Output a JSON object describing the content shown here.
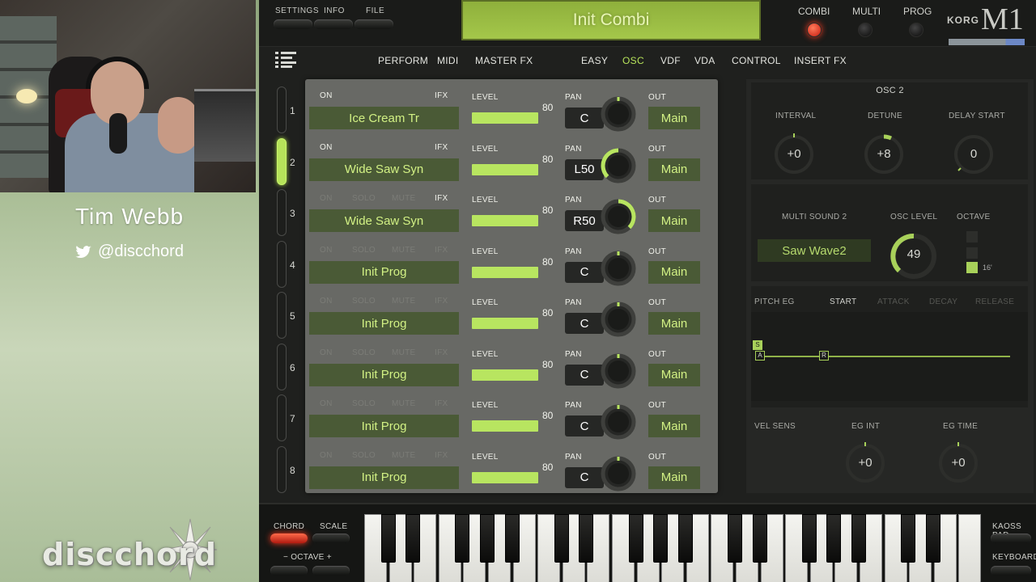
{
  "stream": {
    "host_name": "Tim Webb",
    "host_handle": "@discchord",
    "brand_word": "discchord"
  },
  "topbar": {
    "settings": "SETTINGS",
    "info": "INFO",
    "file": "FILE",
    "display_title": "Init Combi",
    "modes": [
      {
        "label": "COMBI",
        "active": true
      },
      {
        "label": "MULTI",
        "active": false
      },
      {
        "label": "PROG",
        "active": false
      }
    ],
    "brand": "KORG",
    "model": "M1"
  },
  "nav": {
    "items": [
      "PERFORM",
      "MIDI",
      "MASTER FX",
      "EASY",
      "OSC",
      "VDF",
      "VDA",
      "CONTROL",
      "INSERT FX"
    ],
    "active": "OSC"
  },
  "parts": {
    "numbers": [
      "1",
      "2",
      "3",
      "4",
      "5",
      "6",
      "7",
      "8"
    ],
    "active_index": 1
  },
  "timbres": {
    "labels": {
      "on": "ON",
      "solo": "SOLO",
      "mute": "MUTE",
      "ifx": "IFX",
      "level": "LEVEL",
      "pan": "PAN",
      "out": "OUT"
    },
    "rows": [
      {
        "program": "Ice Cream Tr",
        "level": 80,
        "pan": "C",
        "pan_value": 0,
        "out": "Main",
        "on_lit": true,
        "ifx_lit": true
      },
      {
        "program": "Wide Saw Syn",
        "level": 80,
        "pan": "L50",
        "pan_value": -50,
        "out": "Main",
        "on_lit": true,
        "ifx_lit": true
      },
      {
        "program": "Wide Saw Syn",
        "level": 80,
        "pan": "R50",
        "pan_value": 50,
        "out": "Main",
        "on_lit": false,
        "ifx_lit": true
      },
      {
        "program": "Init Prog",
        "level": 80,
        "pan": "C",
        "pan_value": 0,
        "out": "Main",
        "on_lit": false,
        "ifx_lit": false
      },
      {
        "program": "Init Prog",
        "level": 80,
        "pan": "C",
        "pan_value": 0,
        "out": "Main",
        "on_lit": false,
        "ifx_lit": false
      },
      {
        "program": "Init Prog",
        "level": 80,
        "pan": "C",
        "pan_value": 0,
        "out": "Main",
        "on_lit": false,
        "ifx_lit": false
      },
      {
        "program": "Init Prog",
        "level": 80,
        "pan": "C",
        "pan_value": 0,
        "out": "Main",
        "on_lit": false,
        "ifx_lit": false
      },
      {
        "program": "Init Prog",
        "level": 80,
        "pan": "C",
        "pan_value": 0,
        "out": "Main",
        "on_lit": false,
        "ifx_lit": false
      }
    ]
  },
  "osc2": {
    "title": "OSC 2",
    "interval_label": "INTERVAL",
    "interval_value": "+0",
    "detune_label": "DETUNE",
    "detune_value": "+8",
    "delay_label": "DELAY START",
    "delay_value": "0",
    "multisound_label": "MULTI SOUND 2",
    "multisound_value": "Saw Wave2",
    "osc_level_label": "OSC LEVEL",
    "osc_level_value": "49",
    "octave_label": "OCTAVE",
    "octave_selected": "16'",
    "pitch_eg_label": "PITCH EG",
    "eg_tabs": [
      "START",
      "ATTACK",
      "DECAY",
      "RELEASE"
    ],
    "eg_points": [
      "S",
      "A",
      "R"
    ],
    "vel_sens_label": "VEL SENS",
    "eg_int_label": "EG INT",
    "eg_int_value": "+0",
    "eg_time_label": "EG TIME",
    "eg_time_value": "+0"
  },
  "keyboard": {
    "chord": "CHORD",
    "scale": "SCALE",
    "octave": "− OCTAVE +",
    "kaoss_pad": "KAOSS PAD",
    "keyboard": "KEYBOARD"
  },
  "colors": {
    "accent": "#b6e35a",
    "display_bg": "#a4c74a",
    "led_on": "#e8281a",
    "panel": "#686965"
  }
}
